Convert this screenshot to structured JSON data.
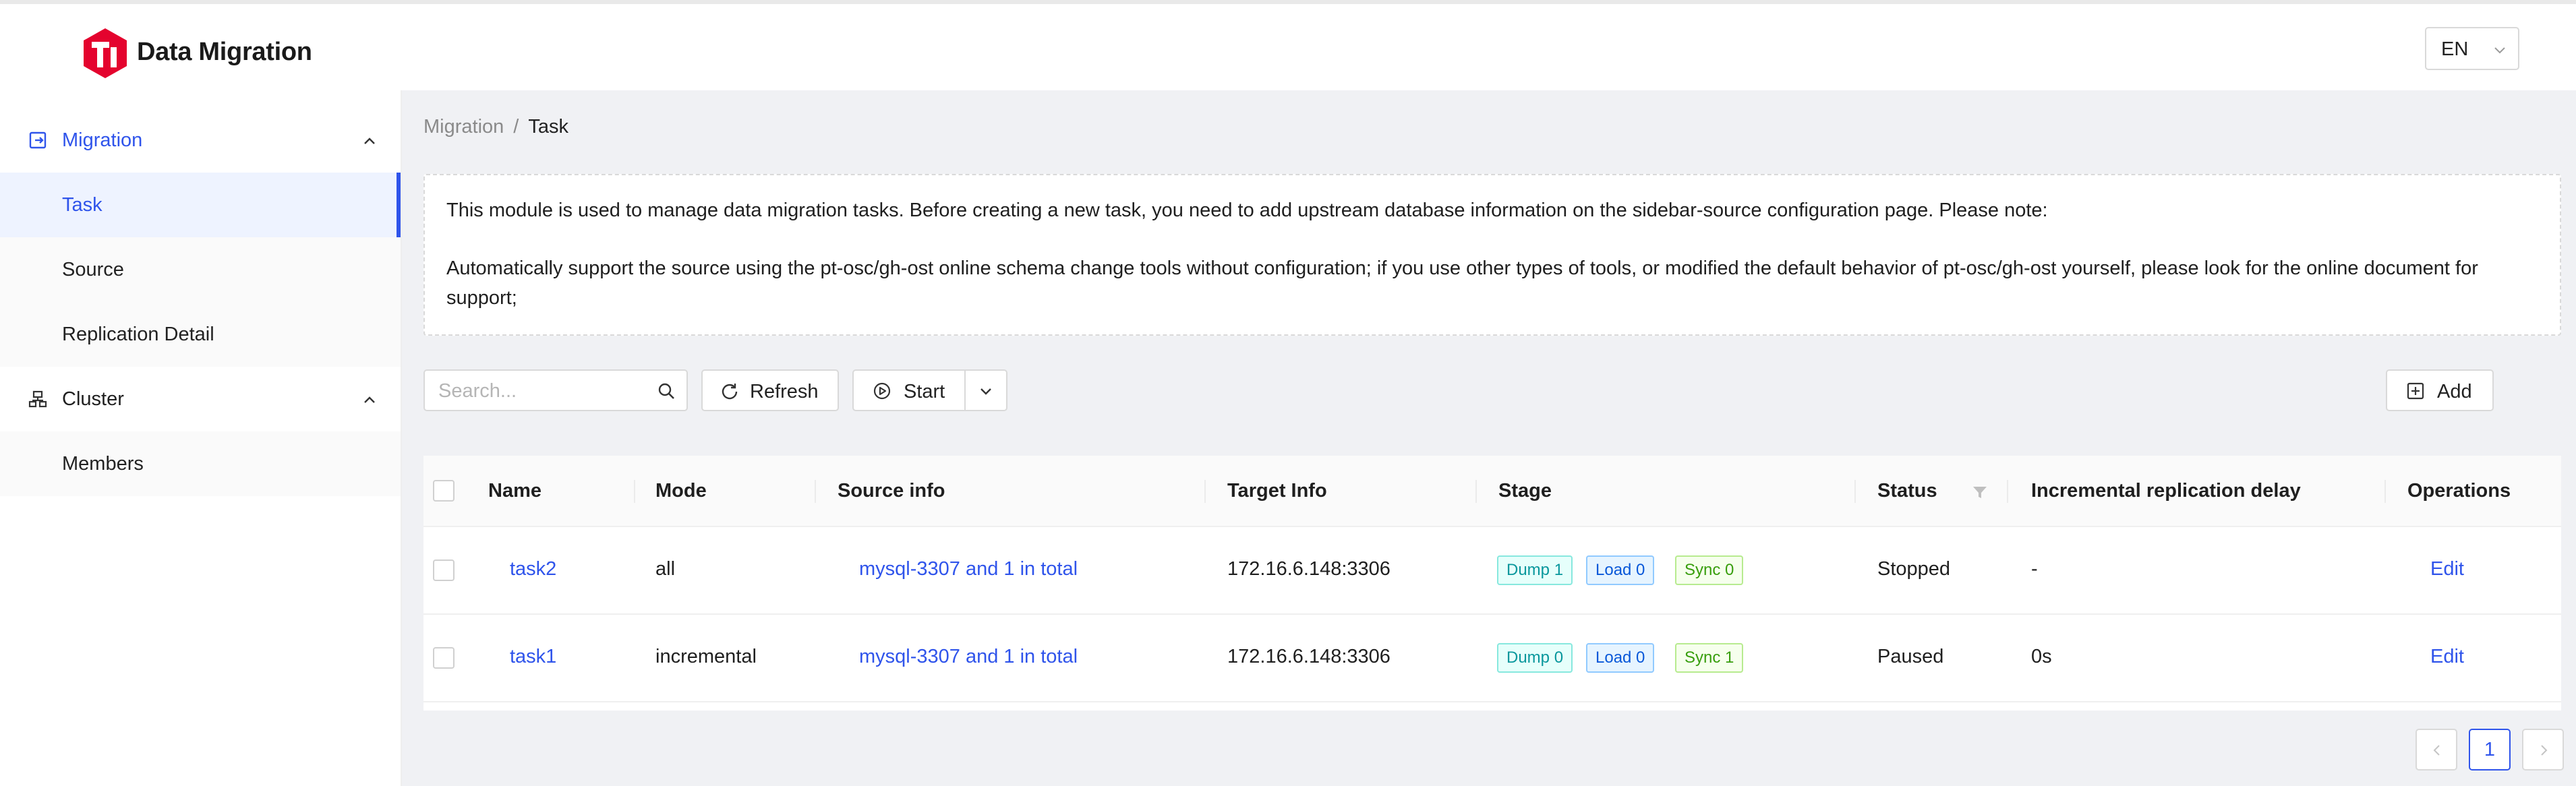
{
  "app": {
    "brand_title": "Data Migration",
    "language": "EN",
    "brand_color": "#e4032e",
    "accent_color": "#2f54eb"
  },
  "sidebar": {
    "groups": [
      {
        "label": "Migration",
        "icon": "migration-icon",
        "expanded": true,
        "items": [
          {
            "label": "Task",
            "active": true
          },
          {
            "label": "Source",
            "active": false
          },
          {
            "label": "Replication Detail",
            "active": false
          }
        ]
      },
      {
        "label": "Cluster",
        "icon": "cluster-icon",
        "expanded": true,
        "items": [
          {
            "label": "Members",
            "active": false
          }
        ]
      }
    ]
  },
  "breadcrumb": [
    "Migration",
    "Task"
  ],
  "breadcrumb_separator": "/",
  "notice": {
    "line1": "This module is used to manage data migration tasks. Before creating a new task, you need to add upstream database information on the sidebar-source configuration page. Please note:",
    "line2": "Automatically support the source using the pt-osc/gh-ost online schema change tools without configuration; if you use other types of tools, or modified the default behavior of pt-osc/gh-ost yourself, please look for the online document for support;"
  },
  "toolbar": {
    "search_placeholder": "Search...",
    "search_value": "",
    "refresh_label": "Refresh",
    "start_label": "Start",
    "add_label": "Add"
  },
  "table": {
    "columns": [
      "Name",
      "Mode",
      "Source info",
      "Target Info",
      "Stage",
      "Status",
      "Incremental replication delay",
      "Operations"
    ],
    "rows": [
      {
        "name": "task2",
        "mode": "all",
        "source": "mysql-3307 and 1 in total",
        "target": "172.16.6.148:3306",
        "stage": {
          "dump": "Dump 1",
          "load": "Load 0",
          "sync": "Sync 0"
        },
        "status": "Stopped",
        "delay": "-",
        "operation": "Edit"
      },
      {
        "name": "task1",
        "mode": "incremental",
        "source": "mysql-3307 and 1 in total",
        "target": "172.16.6.148:3306",
        "stage": {
          "dump": "Dump 0",
          "load": "Load 0",
          "sync": "Sync 1"
        },
        "status": "Paused",
        "delay": "0s",
        "operation": "Edit"
      }
    ]
  },
  "pagination": {
    "current_page": "1"
  }
}
